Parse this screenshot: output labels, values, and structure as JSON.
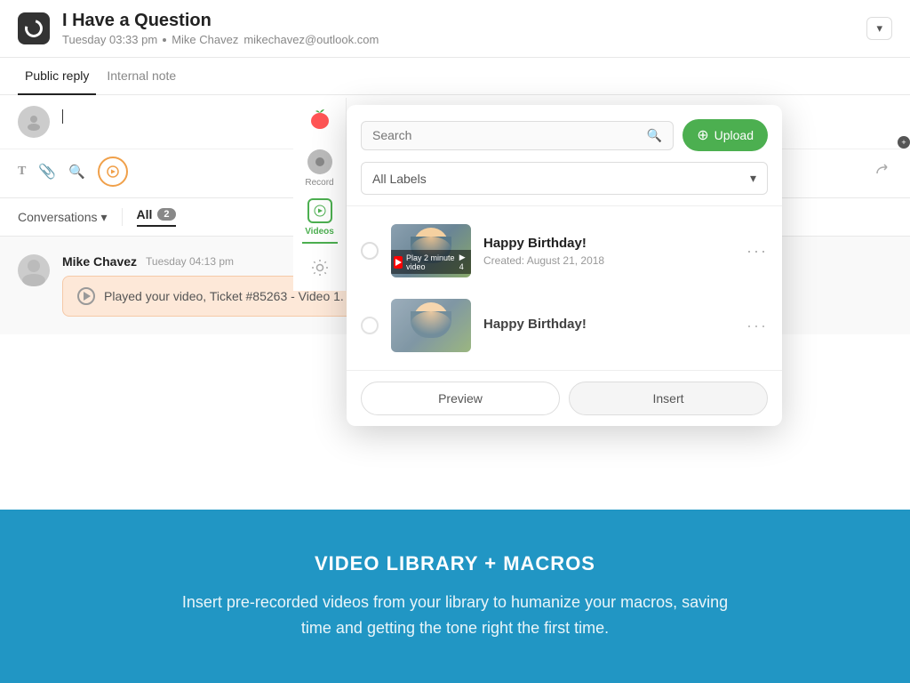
{
  "header": {
    "title": "I Have a Question",
    "meta_day": "Tuesday 03:33 pm",
    "meta_dot": "•",
    "meta_user": "Mike Chavez",
    "meta_email": "mikechavez@outlook.com",
    "dropdown_label": "▾"
  },
  "reply": {
    "tab_public": "Public reply",
    "tab_internal": "Internal note",
    "placeholder": ""
  },
  "conversations": {
    "label": "Conversations",
    "chevron": "▾",
    "tab_all": "All",
    "badge": "2"
  },
  "message": {
    "name": "Mike Chavez",
    "time": "Tuesday 04:13 pm",
    "bubble_text": "Played your video, Ticket #85263 - Video 1."
  },
  "overlay": {
    "search_placeholder": "Search",
    "upload_label": "Upload",
    "labels_default": "All Labels",
    "video1_title": "Happy Birthday!",
    "video1_date": "Created: August 21, 2018",
    "video2_title": "Happy Birthday!",
    "btn_preview": "Preview",
    "btn_insert": "Insert"
  },
  "sidebar": {
    "record_label": "Record",
    "videos_label": "Videos"
  },
  "promo": {
    "title": "VIDEO LIBRARY + MACROS",
    "text": "Insert pre-recorded videos from your library to humanize your macros, saving time and getting the tone right the first time."
  }
}
